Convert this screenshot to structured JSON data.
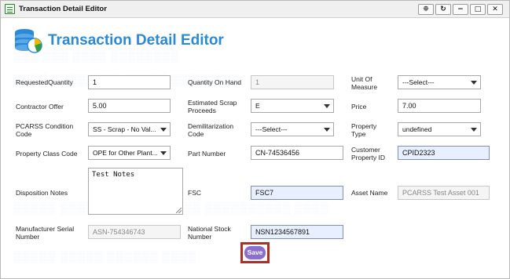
{
  "window": {
    "title": "Transaction Detail Editor",
    "controls": [
      "pin",
      "refresh",
      "minimize",
      "maximize",
      "close"
    ]
  },
  "header": {
    "title": "Transaction Detail Editor",
    "icon": "database-chart-icon"
  },
  "fields": {
    "requested_quantity": {
      "label": "RequestedQuantity",
      "value": "1"
    },
    "quantity_on_hand": {
      "label": "Quantity On Hand",
      "placeholder": "1"
    },
    "unit_of_measure": {
      "label_line1": "Unit Of",
      "label_line2": "Measure",
      "value": "---Select---"
    },
    "contractor_offer": {
      "label": "Contractor Offer",
      "value": "5.00"
    },
    "estimated_scrap_proceeds": {
      "label_line1": "Estimated Scrap",
      "label_line2": "Proceeds",
      "value": "E"
    },
    "price": {
      "label": "Price",
      "value": "7.00"
    },
    "pcarss_condition_code": {
      "label_line1": "PCARSS Condition",
      "label_line2": "Code",
      "value": "SS - Scrap - No Val..."
    },
    "demilitarization_code": {
      "label_line1": "Demilitarization",
      "label_line2": "Code",
      "value": "---Select---"
    },
    "property_type": {
      "label_line1": "Property",
      "label_line2": "Type",
      "value": "undefined"
    },
    "property_class_code": {
      "label": "Property Class Code",
      "value": "OPE for Other Plant..."
    },
    "part_number": {
      "label": "Part Number",
      "value": "CN-74536456"
    },
    "customer_property_id": {
      "label_line1": "Customer",
      "label_line2": "Property ID",
      "value": "CPID2323"
    },
    "disposition_notes": {
      "label": "Disposition Notes",
      "value": "Test Notes"
    },
    "fsc": {
      "label": "FSC",
      "value": "FSC7"
    },
    "asset_name": {
      "label": "Asset Name",
      "value": "PCARSS Test Asset 001"
    },
    "manufacturer_serial_number": {
      "label_line1": "Manufacturer Serial",
      "label_line2": "Number",
      "value": "ASN-754346743"
    },
    "national_stock_number": {
      "label_line1": "National Stock",
      "label_line2": "Number",
      "value": "NSN1234567891"
    }
  },
  "actions": {
    "save_label": "Save"
  },
  "colors": {
    "title_blue": "#2a8ad8",
    "save_purple": "#8b6fd0",
    "save_frame_red": "#a93226",
    "highlight_field": "#e8efff"
  }
}
